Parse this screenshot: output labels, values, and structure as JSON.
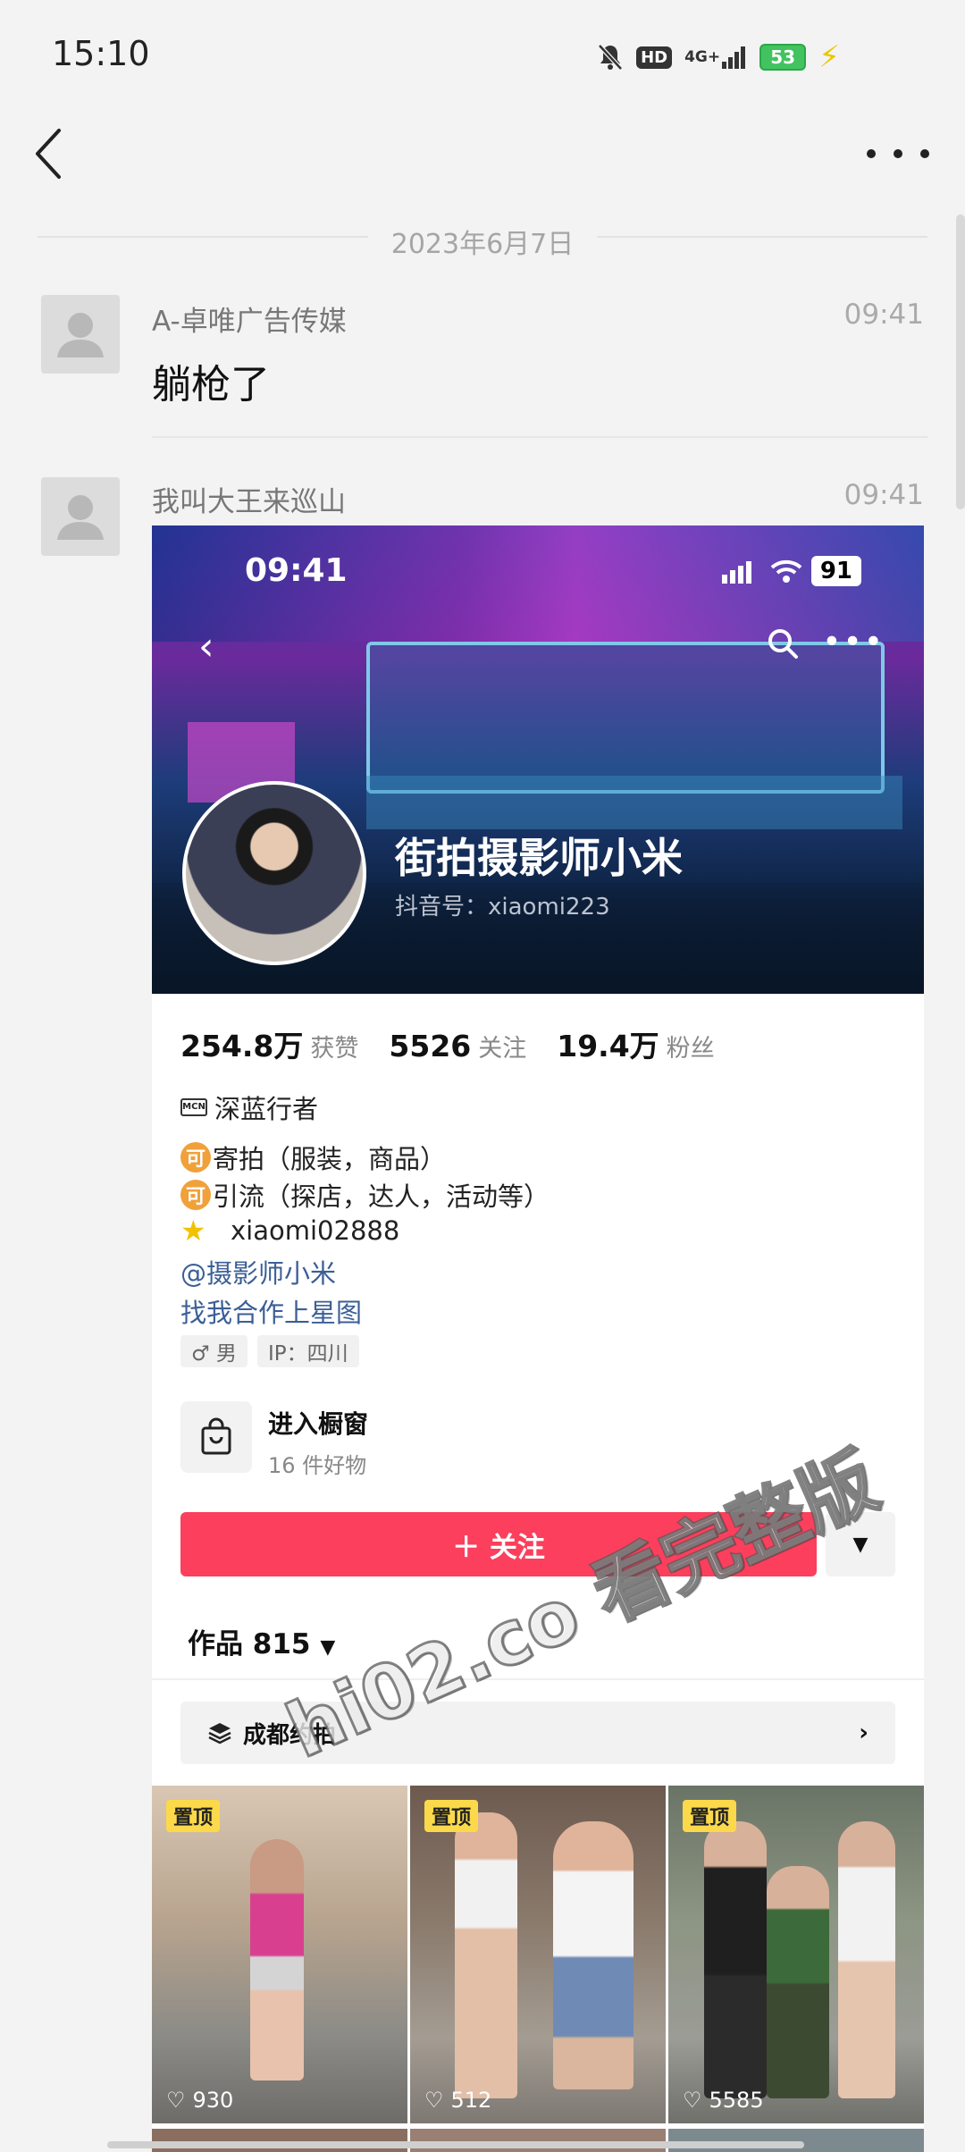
{
  "status_bar": {
    "time": "15:10",
    "hd_label": "HD",
    "network_label": "4G+",
    "battery_level": "53"
  },
  "chat": {
    "date_divider": "2023年6月7日",
    "messages": [
      {
        "sender": "A-卓唯广告传媒",
        "time": "09:41",
        "text": "躺枪了"
      },
      {
        "sender": "我叫大王来巡山",
        "time": "09:41"
      }
    ]
  },
  "profile_card": {
    "phone_time": "09:41",
    "phone_battery": "91",
    "nickname": "街拍摄影师小米",
    "douyin_id": "抖音号：xiaomi223",
    "stats": [
      {
        "value": "254.8万",
        "label": "获赞"
      },
      {
        "value": "5526",
        "label": "关注"
      },
      {
        "value": "19.4万",
        "label": "粉丝"
      }
    ],
    "mcn_label": "MCN",
    "mcn_name": "深蓝行者",
    "coin_glyph": "可",
    "bio_lines": [
      "寄拍（服装，商品）",
      "引流（探店，达人，活动等）"
    ],
    "contact": "xiaomi02888",
    "mention_link": "@摄影师小米",
    "xingtu_link": "找我合作上星图",
    "tags": [
      "♂ 男",
      "IP：四川"
    ],
    "shop": {
      "title": "进入橱窗",
      "subtitle": "16 件好物"
    },
    "follow_button": "＋ 关注",
    "works_label": "作品 815",
    "collection_label": "成都约拍",
    "videos": [
      {
        "pinned_label": "置顶",
        "likes": "930"
      },
      {
        "pinned_label": "置顶",
        "likes": "512"
      },
      {
        "pinned_label": "置顶",
        "likes": "5585"
      }
    ],
    "watermark": "hi02.co 看完整版"
  },
  "colors": {
    "follow_button": "#fb3f5c",
    "link": "#3b5f96",
    "pinned_badge": "#fbd94a"
  }
}
